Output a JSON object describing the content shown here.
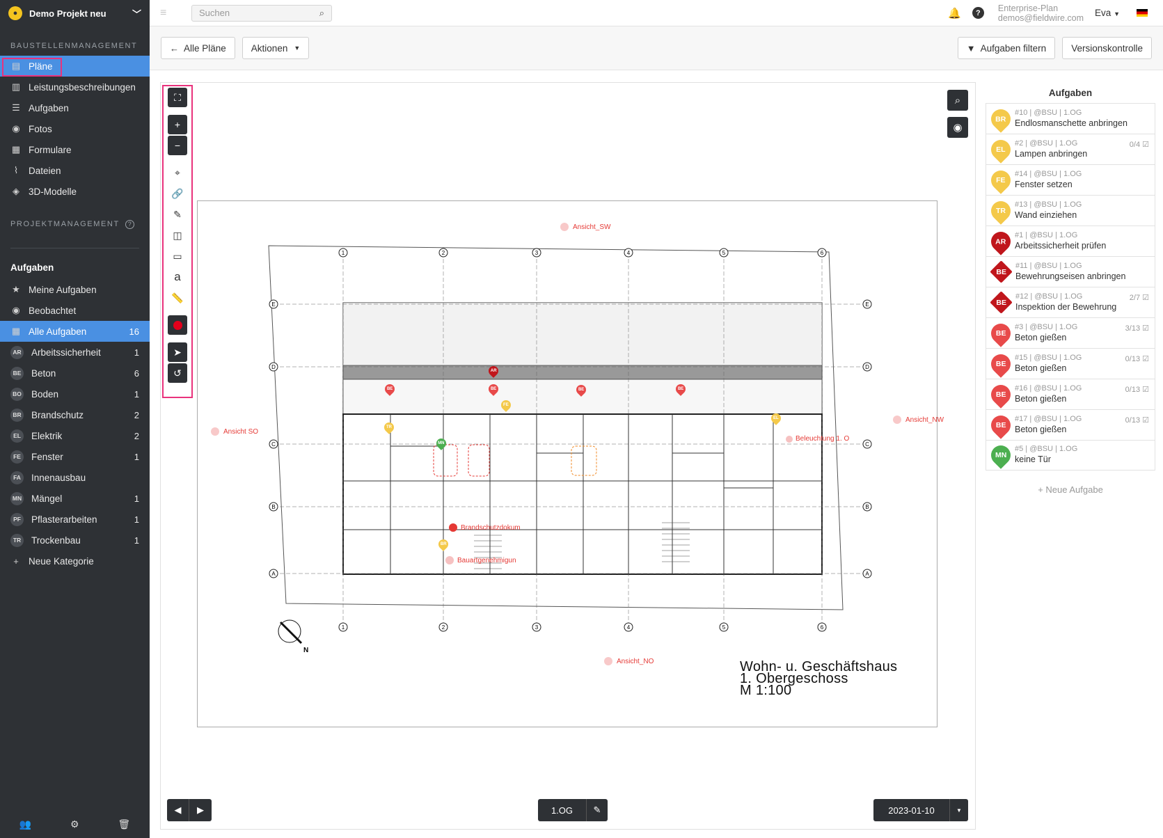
{
  "sidebar": {
    "project": "Demo Projekt neu",
    "section1": "BAUSTELLENMANAGEMENT",
    "items": [
      {
        "label": "Pläne",
        "icon": "plans-icon"
      },
      {
        "label": "Leistungsbeschreibungen",
        "icon": "spec-book-icon"
      },
      {
        "label": "Aufgaben",
        "icon": "list-icon"
      },
      {
        "label": "Fotos",
        "icon": "camera-icon"
      },
      {
        "label": "Formulare",
        "icon": "clipboard-icon"
      },
      {
        "label": "Dateien",
        "icon": "paperclip-icon"
      },
      {
        "label": "3D-Modelle",
        "icon": "cube-icon"
      }
    ],
    "section2": "PROJEKTMANAGEMENT",
    "tasks_heading": "Aufgaben",
    "task_filters": [
      {
        "label": "Meine Aufgaben",
        "icon": "star-icon"
      },
      {
        "label": "Beobachtet",
        "icon": "eye-icon"
      },
      {
        "label": "Alle Aufgaben",
        "count": "16",
        "icon": "grid-icon"
      }
    ],
    "categories": [
      {
        "code": "AR",
        "label": "Arbeitssicherheit",
        "count": "1"
      },
      {
        "code": "BE",
        "label": "Beton",
        "count": "6"
      },
      {
        "code": "BO",
        "label": "Boden",
        "count": "1"
      },
      {
        "code": "BR",
        "label": "Brandschutz",
        "count": "2"
      },
      {
        "code": "EL",
        "label": "Elektrik",
        "count": "2"
      },
      {
        "code": "FE",
        "label": "Fenster",
        "count": "1"
      },
      {
        "code": "FA",
        "label": "Innenausbau",
        "count": ""
      },
      {
        "code": "MN",
        "label": "Mängel",
        "count": "1"
      },
      {
        "code": "PF",
        "label": "Pflasterarbeiten",
        "count": "1"
      },
      {
        "code": "TR",
        "label": "Trockenbau",
        "count": "1"
      }
    ],
    "new_category": "Neue Kategorie"
  },
  "topbar": {
    "search_placeholder": "Suchen",
    "plan_type": "Enterprise-Plan",
    "email": "demos@fieldwire.com",
    "user": "Eva"
  },
  "actionbar": {
    "back_label": "Alle Pläne",
    "actions_label": "Aktionen",
    "filter_label": "Aufgaben filtern",
    "version_label": "Versionskontrolle"
  },
  "plan": {
    "views": [
      "Ansicht_SW",
      "Ansicht SO",
      "Ansicht_NW",
      "Ansicht_NO"
    ],
    "title_lines": [
      "Wohn- u. Geschäftshaus",
      "1. Obergeschoss",
      "M 1:100"
    ],
    "markers": [
      "Brandschutzdokum",
      "Bauartgenehmigun",
      "Beleuchtung 1. O"
    ],
    "sheet_name": "1.OG",
    "version_date": "2023-01-10",
    "axis_cols": [
      "1",
      "2",
      "3",
      "4",
      "5",
      "6"
    ],
    "axis_rows": [
      "E",
      "D",
      "C",
      "B",
      "A"
    ],
    "north": "N"
  },
  "tasks": {
    "heading": "Aufgaben",
    "items": [
      {
        "code": "BR",
        "meta": "#10 | @BSU | 1.OG",
        "title": "Endlosmanschette anbringen",
        "count": "",
        "color": "#f4c94a",
        "shape": "pin"
      },
      {
        "code": "EL",
        "meta": "#2 | @BSU | 1.OG",
        "title": "Lampen anbringen",
        "count": "0/4",
        "color": "#f4c94a",
        "shape": "pin"
      },
      {
        "code": "FE",
        "meta": "#14 | @BSU | 1.OG",
        "title": "Fenster setzen",
        "count": "",
        "color": "#f4c94a",
        "shape": "pin"
      },
      {
        "code": "TR",
        "meta": "#13 | @BSU | 1.OG",
        "title": "Wand einziehen",
        "count": "",
        "color": "#f4c94a",
        "shape": "pin"
      },
      {
        "code": "AR",
        "meta": "#1 | @BSU | 1.OG",
        "title": "Arbeitssicherheit prüfen",
        "count": "",
        "color": "#c0161c",
        "shape": "pin"
      },
      {
        "code": "BE",
        "meta": "#11 | @BSU | 1.OG",
        "title": "Bewehrungseisen anbringen",
        "count": "",
        "color": "#c0161c",
        "shape": "dia"
      },
      {
        "code": "BE",
        "meta": "#12 | @BSU | 1.OG",
        "title": "Inspektion der Bewehrung",
        "count": "2/7",
        "color": "#c0161c",
        "shape": "dia"
      },
      {
        "code": "BE",
        "meta": "#3 | @BSU | 1.OG",
        "title": "Beton gießen",
        "count": "3/13",
        "color": "#e84a4a",
        "shape": "pin"
      },
      {
        "code": "BE",
        "meta": "#15 | @BSU | 1.OG",
        "title": "Beton gießen",
        "count": "0/13",
        "color": "#e84a4a",
        "shape": "pin"
      },
      {
        "code": "BE",
        "meta": "#16 | @BSU | 1.OG",
        "title": "Beton gießen",
        "count": "0/13",
        "color": "#e84a4a",
        "shape": "pin"
      },
      {
        "code": "BE",
        "meta": "#17 | @BSU | 1.OG",
        "title": "Beton gießen",
        "count": "0/13",
        "color": "#e84a4a",
        "shape": "pin"
      },
      {
        "code": "MN",
        "meta": "#5 | @BSU | 1.OG",
        "title": "keine Tür",
        "count": "",
        "color": "#4caf50",
        "shape": "pin"
      }
    ],
    "new_task": "+ Neue Aufgabe"
  },
  "colors": {
    "accent": "#4a90e2",
    "sidebar": "#2e3135",
    "highlight": "#e9327c"
  }
}
